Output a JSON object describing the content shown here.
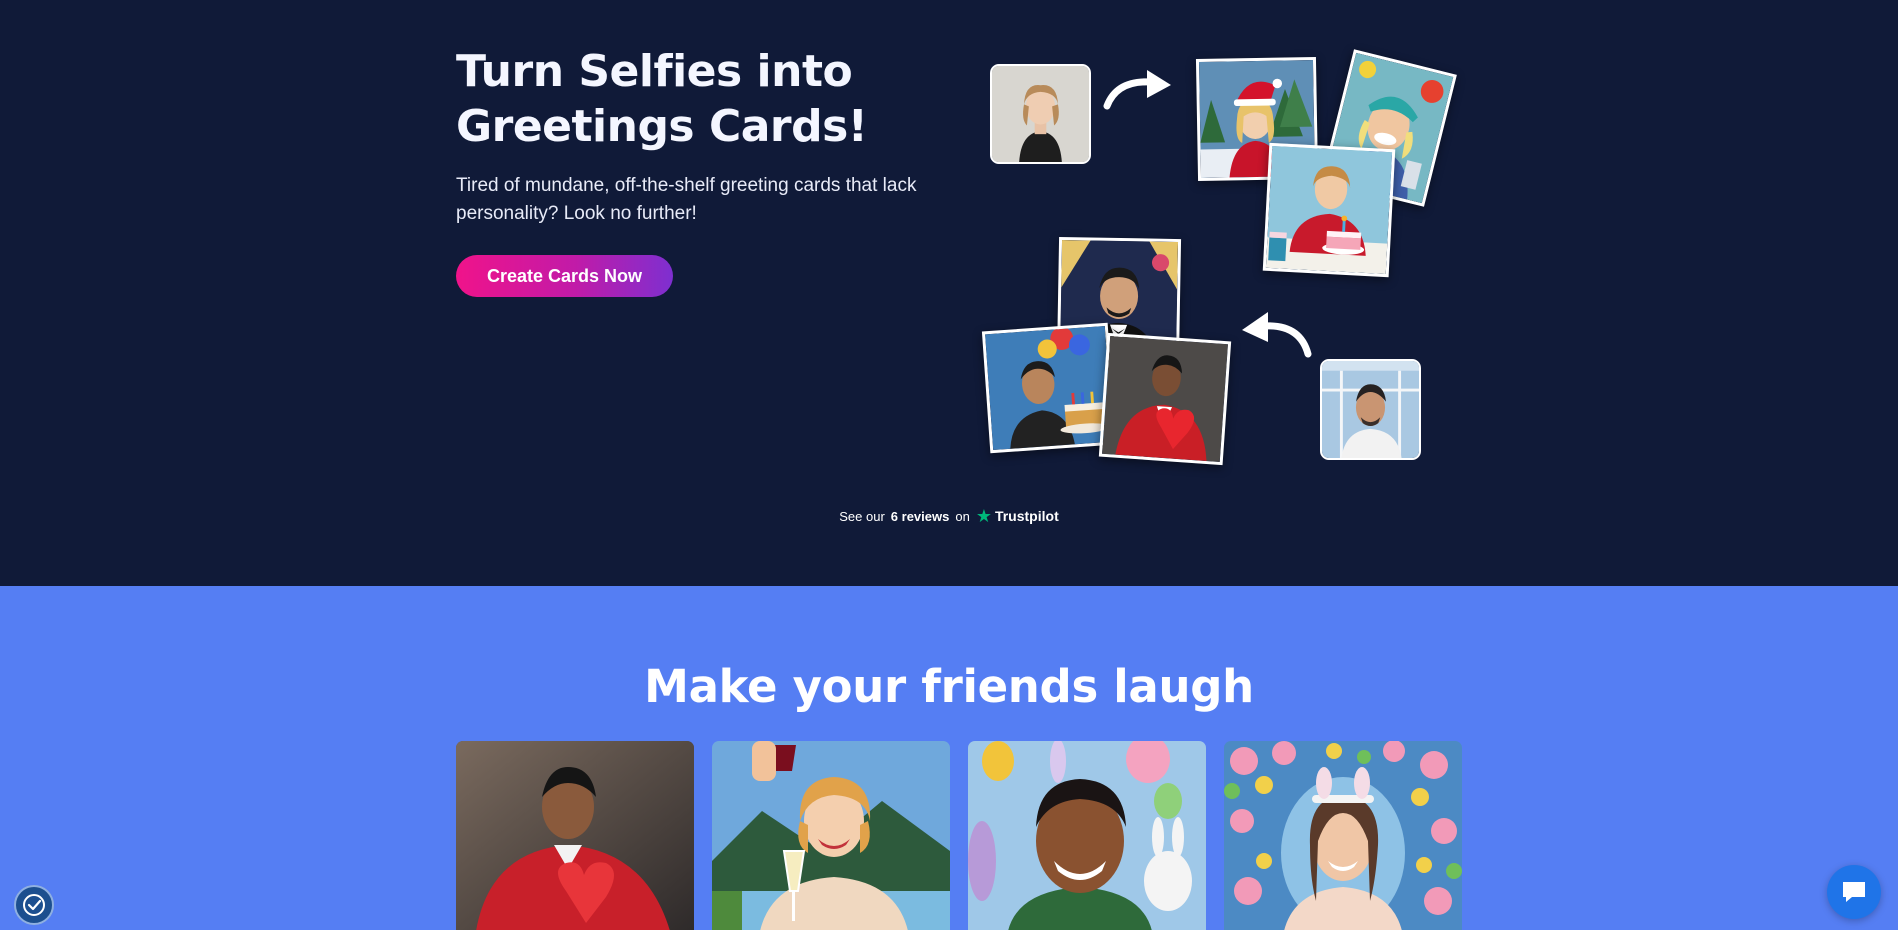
{
  "hero": {
    "title_line1": "Turn Selfies into",
    "title_line2": "Greetings Cards!",
    "subtitle": "Tired of mundane, off-the-shelf greeting cards that lack personality? Look no further!",
    "cta_label": "Create Cards Now"
  },
  "trustpilot": {
    "prefix": "See our",
    "count_label": "6 reviews",
    "suffix": "on",
    "brand": "Trustpilot"
  },
  "laugh_section": {
    "title": "Make your friends laugh",
    "cards": [
      {
        "alt": "Valentine portrait card"
      },
      {
        "alt": "Champagne toast card"
      },
      {
        "alt": "Easter bunny card"
      },
      {
        "alt": "Floral Easter card"
      }
    ]
  },
  "widgets": {
    "accessibility_icon": "accessibility-icon",
    "chat_icon": "chat-bubble-icon"
  },
  "colors": {
    "hero_bg": "#101a38",
    "section_bg": "#557ef3",
    "cta_gradient_start": "#f0138a",
    "cta_gradient_end": "#7e2fd0",
    "trustpilot_green": "#00b67a",
    "chat_button": "#1f74e8"
  }
}
